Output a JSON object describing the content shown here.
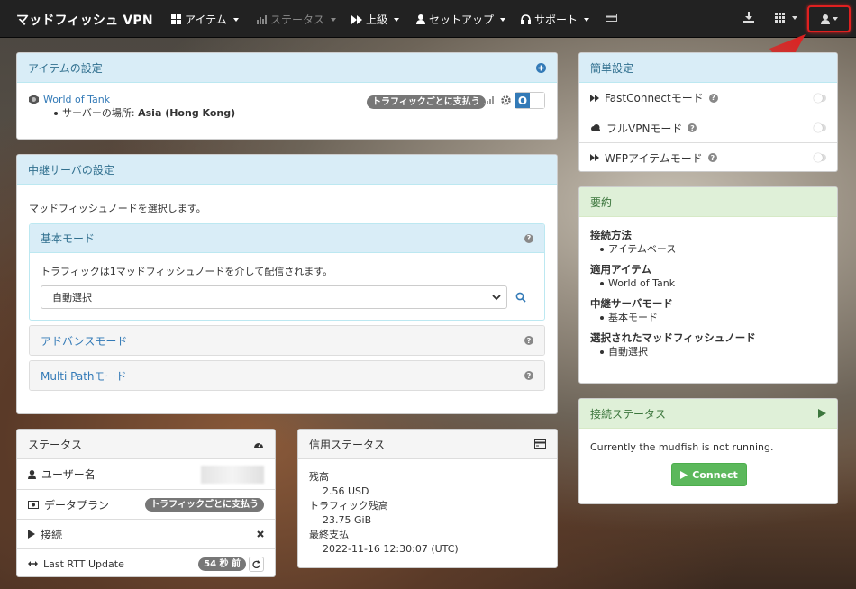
{
  "navbar": {
    "brand": "マッドフィッシュ VPN",
    "items": [
      {
        "label": "アイテム",
        "icon": "grid-icon"
      },
      {
        "label": "ステータス",
        "icon": "bar-chart-icon"
      },
      {
        "label": "上級",
        "icon": "fast-forward-icon"
      },
      {
        "label": "セットアップ",
        "icon": "user-icon"
      },
      {
        "label": "サポート",
        "icon": "headphones-icon"
      }
    ],
    "right": [
      "download-icon",
      "grid-menu-icon",
      "user-menu-icon"
    ]
  },
  "item_settings": {
    "title": "アイテムの設定",
    "item_name": "World of Tank",
    "server_location_label": "サーバーの場所:",
    "server_location_value": "Asia (Hong Kong)",
    "billing_badge": "トラフィックごとに支払う",
    "toggle_label": "O"
  },
  "relay": {
    "title": "中継サーバの設定",
    "intro": "マッドフィッシュノードを選択します。",
    "basic_mode_title": "基本モード",
    "basic_mode_desc": "トラフィックは1マッドフィッシュノードを介して配信されます。",
    "select_value": "自動選択",
    "advanced_mode_title": "アドバンスモード",
    "multipath_mode_title": "Multi Pathモード"
  },
  "status": {
    "title": "ステータス",
    "username_label": "ユーザー名",
    "plan_label": "データプラン",
    "plan_badge": "トラフィックごとに支払う",
    "connect_label": "接続",
    "rtt_label": "Last RTT Update",
    "rtt_badge": "54 秒 前"
  },
  "credit": {
    "title": "信用ステータス",
    "balance_label": "残高",
    "balance_value": "2.56 USD",
    "traffic_label": "トラフィック残高",
    "traffic_value": "23.75 GiB",
    "last_payment_label": "最終支払",
    "last_payment_value": "2022-11-16 12:30:07 (UTC)"
  },
  "easy": {
    "title": "簡単設定",
    "rows": [
      "FastConnectモード",
      "フルVPNモード",
      "WFPアイテムモード"
    ]
  },
  "summary": {
    "title": "要約",
    "method_label": "接続方法",
    "method_value": "アイテムベース",
    "items_label": "適用アイテム",
    "items_value": "World of Tank",
    "relay_label": "中継サーバモード",
    "relay_value": "基本モード",
    "node_label": "選択されたマッドフィッシュノード",
    "node_value": "自動選択"
  },
  "conn": {
    "title": "接続ステータス",
    "message": "Currently the mudfish is not running.",
    "button": "Connect"
  },
  "colors": {
    "accent": "#337ab7",
    "success": "#5cb85c",
    "highlight": "#e02020"
  }
}
